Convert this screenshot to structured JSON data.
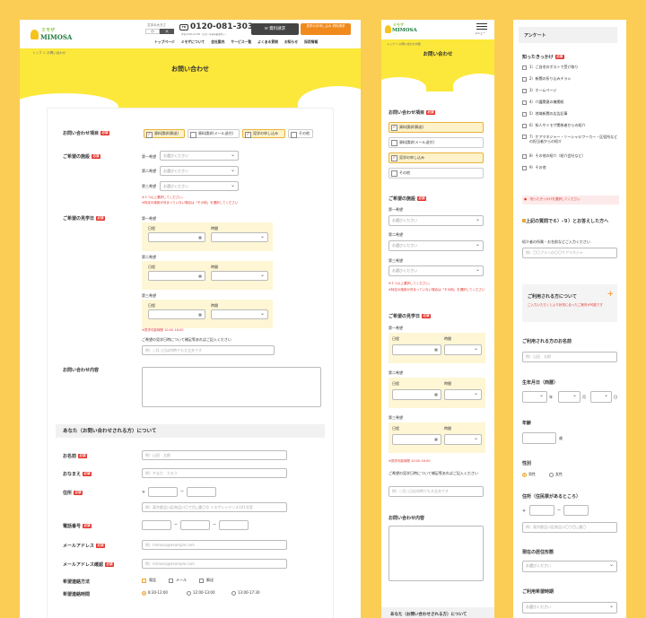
{
  "brand": {
    "name": "MIMOSA",
    "tag": "ミモザ"
  },
  "desktop": {
    "font_size_label": "文字の大きさ",
    "font_small": "小",
    "font_large": "大",
    "phone": "0120-081-303",
    "hours": "平日 9:00〜17:30（土日・年末年始を除く）",
    "btn_material": "資料請求",
    "btn_visit": "見学のお申し込み 資料請求",
    "nav": [
      "トップページ",
      "ミモザについて",
      "会社案内",
      "サービス一覧",
      "よくある質問",
      "お知らせ",
      "採用情報"
    ],
    "breadcrumb": "トップ ＞ お問い合わせ",
    "title": "お問い合わせ",
    "inquiry_label": "お問い合わせ項目",
    "inquiry_options": [
      "資料請求(郵送)",
      "資料請求(メール送付)",
      "見学の申し込み",
      "その他"
    ],
    "facility_label": "ご希望の施設",
    "choices": [
      "第一希望",
      "第二希望",
      "第三希望"
    ],
    "select_placeholder": "お選びください",
    "facility_note1": "※１つ以上選択してください。",
    "facility_note2": "※特定の施設が決まっていない場合は「その他」を選択してください",
    "visit_label": "ご希望の見学日",
    "date_label": "日程",
    "time_label": "時間",
    "visit_hours": "※見学可能時間 10:00-16:00",
    "visit_extra": "ご希望の見学日時について補足等あればご記入ください",
    "visit_extra_ph": "例）○月○日は何時でも大丈夫です",
    "content_label": "お問い合わせ内容",
    "section_you": "あなた（お問い合わせされる方）について",
    "name_label": "お名前",
    "name_ph": "例）山田　太郎",
    "kana_label": "おなまえ",
    "kana_ph": "例）やまだ　たろう",
    "address_label": "住所",
    "zip_mark": "〒",
    "address_ph": "例）東京都品川区南品川〇丁目△番〇号 ミモザレジデンス101号室",
    "tel_label": "電話番号",
    "email_label": "メールアドレス",
    "email_ph": "例）mimosa@example.com",
    "email2_label": "メールアドレス確認",
    "email2_ph": "例）mimosa@example.com",
    "contact_method_label": "希望連絡方法",
    "contact_methods": [
      "電話",
      "メール",
      "郵送"
    ],
    "contact_time_label": "希望連絡時間",
    "contact_times": [
      "8:30-12:00",
      "12:00-13:00",
      "13:00-17:30"
    ]
  },
  "mobile1": {
    "menu": "メニュー",
    "breadcrumb": "トップ ＞ お問い合わせ内容",
    "title": "お問い合わせ",
    "inquiry_label": "お問い合わせ項目",
    "inquiry_options": [
      "資料請求(郵送)",
      "資料請求(メール送付)",
      "見学の申し込み",
      "その他"
    ],
    "facility_label": "ご希望の施設",
    "choices": [
      "第一希望",
      "第二希望",
      "第三希望"
    ],
    "select_placeholder": "お選びください",
    "note1": "※１つ以上選択してください。",
    "note2": "※特定の施設が決まっていない場合は「その他」を選択してください",
    "visit_label": "ご希望の見学日",
    "date_label": "日程",
    "time_label": "時間",
    "visit_hours": "※見学可能時間 10:00-16:00",
    "visit_extra": "ご希望の見学日時について補足等あればご記入ください",
    "visit_extra_ph": "例）○月○日は何時でも大丈夫です",
    "content_label": "お問い合わせ内容",
    "section_you": "あなた（お問い合わせされる方）について"
  },
  "mobile2": {
    "survey": "アンケート",
    "know_label": "知ったきっかけ",
    "know_options": [
      "1）ご自宅のポストで受け取り",
      "2）新聞の折り込みチラシ",
      "3）ホームページ",
      "4）介護関連の機関紙",
      "5）地域新聞の広告記事",
      "6）知人やミモザ関係者からの紹介",
      "7）ケアマネジャー・ソーシャルワーカー・区役所などの担当者からの紹介",
      "8）その他の紹介（紹介会社など）",
      "9）その他"
    ],
    "know_note": "知ったきっかけを選択してください",
    "q_label": "上記の質問で６）-９）とお答えした方へ",
    "q_sub": "紹介者の所属・お名前などご入力ください",
    "q_ph": "例）〇〇プランの〇〇ケアマネジャ",
    "user_box_title": "ご利用される方について",
    "user_box_note": "ご入力いただくとより状況に合ったご案内が可能です",
    "user_name_label": "ご利用される方のお名前",
    "user_name_ph": "例）山田　太郎",
    "birth_label": "生年月日（西暦）",
    "year": "年",
    "month": "月",
    "day": "日",
    "age_label": "年齢",
    "age_unit": "歳",
    "gender_label": "性別",
    "male": "男性",
    "female": "女性",
    "address_label": "住所（住民票があるところ）",
    "zip_mark": "〒",
    "address_ph": "例）東京都品川区南品川〇丁目△番〇",
    "residence_label": "現在の居住形態",
    "select_placeholder": "お選びください",
    "time_label": "ご利用希望時期"
  },
  "colors": {
    "yellow": "#fce83b",
    "orange": "#f08a1d",
    "red": "#e4322b",
    "dark": "#444444"
  }
}
